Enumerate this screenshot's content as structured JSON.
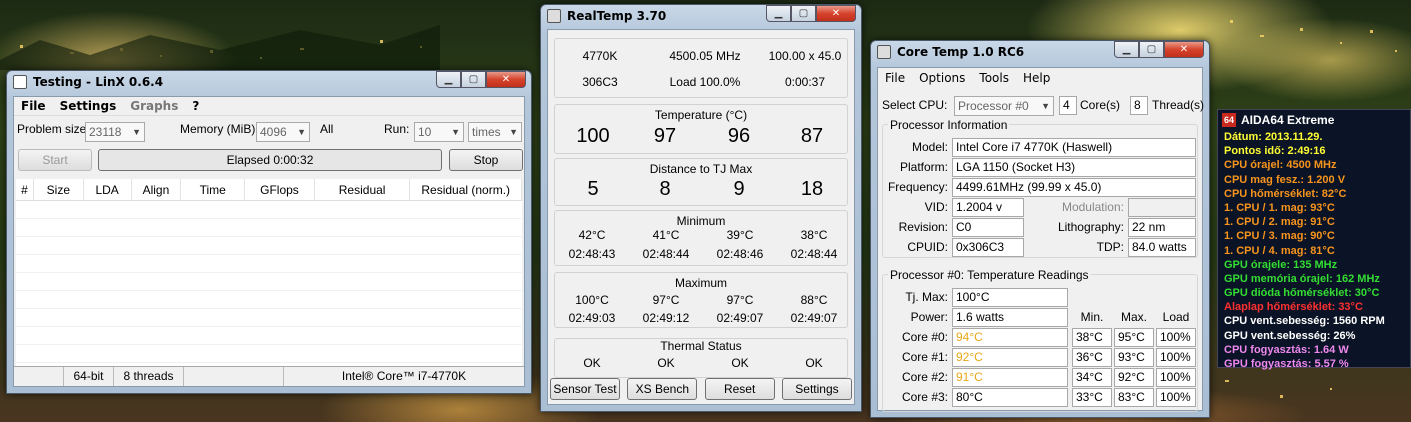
{
  "colors": {
    "aida_yellow": "#ffff33",
    "aida_orange": "#f7941d",
    "aida_green": "#33dd33",
    "aida_red": "#ff3030",
    "aida_white": "#ffffff",
    "aida_pink": "#ee88ee",
    "coretemp_hot": "#e6a817"
  },
  "linx": {
    "title": "Testing - LinX 0.6.4",
    "menu": [
      "File",
      "Settings",
      "Graphs",
      "?"
    ],
    "problem_size_label": "Problem size:",
    "problem_size_value": "23118",
    "memory_label": "Memory (MiB):",
    "memory_value": "4096",
    "all_label": "All",
    "run_label": "Run:",
    "run_value": "10",
    "run_unit": "times",
    "start_label": "Start",
    "elapsed": "Elapsed 0:00:32",
    "stop_label": "Stop",
    "columns": [
      "#",
      "Size",
      "LDA",
      "Align",
      "Time",
      "GFlops",
      "Residual",
      "Residual (norm.)"
    ],
    "status": [
      "",
      "64-bit",
      "8 threads",
      "Intel® Core™ i7-4770K"
    ]
  },
  "realtemp": {
    "title": "RealTemp 3.70",
    "cpu": "4770K",
    "freq": "4500.05 MHz",
    "mult": "100.00 x 45.0",
    "stepping": "306C3",
    "load": "Load 100.0%",
    "time": "0:00:37",
    "temp_title": "Temperature (°C)",
    "temps": [
      "100",
      "97",
      "96",
      "87"
    ],
    "dist_title": "Distance to TJ Max",
    "dists": [
      "5",
      "8",
      "9",
      "18"
    ],
    "min_title": "Minimum",
    "min_temps": [
      "42°C",
      "41°C",
      "39°C",
      "38°C"
    ],
    "min_times": [
      "02:48:43",
      "02:48:44",
      "02:48:46",
      "02:48:44"
    ],
    "max_title": "Maximum",
    "max_temps": [
      "100°C",
      "97°C",
      "97°C",
      "88°C"
    ],
    "max_times": [
      "02:49:03",
      "02:49:12",
      "02:49:07",
      "02:49:07"
    ],
    "thermal_title": "Thermal Status",
    "thermal": [
      "OK",
      "OK",
      "OK",
      "OK"
    ],
    "buttons": [
      "Sensor Test",
      "XS Bench",
      "Reset",
      "Settings"
    ]
  },
  "coretemp": {
    "title": "Core Temp 1.0 RC6",
    "menu": [
      "File",
      "Options",
      "Tools",
      "Help"
    ],
    "select_cpu_label": "Select CPU:",
    "select_cpu_value": "Processor #0",
    "cores_value": "4",
    "cores_label": "Core(s)",
    "threads_value": "8",
    "threads_label": "Thread(s)",
    "proc_info_title": "Processor Information",
    "model_label": "Model:",
    "model_value": "Intel Core i7 4770K (Haswell)",
    "platform_label": "Platform:",
    "platform_value": "LGA 1150 (Socket H3)",
    "frequency_label": "Frequency:",
    "frequency_value": "4499.61MHz (99.99 x 45.0)",
    "vid_label": "VID:",
    "vid_value": "1.2004 v",
    "modulation_label": "Modulation:",
    "revision_label": "Revision:",
    "revision_value": "C0",
    "lithography_label": "Lithography:",
    "lithography_value": "22 nm",
    "cpuid_label": "CPUID:",
    "cpuid_value": "0x306C3",
    "tdp_label": "TDP:",
    "tdp_value": "84.0 watts",
    "readings_title": "Processor #0: Temperature Readings",
    "tjmax_label": "Tj. Max:",
    "tjmax_value": "100°C",
    "min_header": "Min.",
    "max_header": "Max.",
    "load_header": "Load",
    "power_label": "Power:",
    "power_value": "1.6 watts",
    "cores": [
      {
        "label": "Core #0:",
        "temp": "94°C",
        "min": "38°C",
        "max": "95°C",
        "load": "100%"
      },
      {
        "label": "Core #1:",
        "temp": "92°C",
        "min": "36°C",
        "max": "93°C",
        "load": "100%"
      },
      {
        "label": "Core #2:",
        "temp": "91°C",
        "min": "34°C",
        "max": "92°C",
        "load": "100%"
      },
      {
        "label": "Core #3:",
        "temp": "80°C",
        "min": "33°C",
        "max": "83°C",
        "load": "100%"
      }
    ]
  },
  "aida": {
    "title": "AIDA64 Extreme",
    "logo": "64",
    "lines": [
      {
        "text": "Dátum: 2013.11.29.",
        "color": "#ffff33"
      },
      {
        "text": "Pontos idő: 2:49:16",
        "color": "#ffff33"
      },
      {
        "text": "CPU órajel: 4500 MHz",
        "color": "#f7941d"
      },
      {
        "text": "CPU mag fesz.: 1.200 V",
        "color": "#f7941d"
      },
      {
        "text": "CPU hőmérséklet: 82°C",
        "color": "#f7941d"
      },
      {
        "text": "1. CPU / 1. mag: 93°C",
        "color": "#f7941d"
      },
      {
        "text": "1. CPU / 2. mag: 91°C",
        "color": "#f7941d"
      },
      {
        "text": "1. CPU / 3. mag: 90°C",
        "color": "#f7941d"
      },
      {
        "text": "1. CPU / 4. mag: 81°C",
        "color": "#f7941d"
      },
      {
        "text": "GPU órajele: 135 MHz",
        "color": "#33dd33"
      },
      {
        "text": "GPU memória órajel: 162 MHz",
        "color": "#33dd33"
      },
      {
        "text": "GPU dióda hőmérséklet: 30°C",
        "color": "#33dd33"
      },
      {
        "text": "Alaplap hőmérséklet: 33°C",
        "color": "#ff3030"
      },
      {
        "text": "CPU vent.sebesség: 1560 RPM",
        "color": "#ffffff"
      },
      {
        "text": "GPU vent.sebesség: 26%",
        "color": "#ffffff"
      },
      {
        "text": "CPU fogyasztás: 1.64 W",
        "color": "#ee88ee"
      },
      {
        "text": "GPU fogyasztás: 5.57 %",
        "color": "#ee88ee"
      }
    ]
  }
}
